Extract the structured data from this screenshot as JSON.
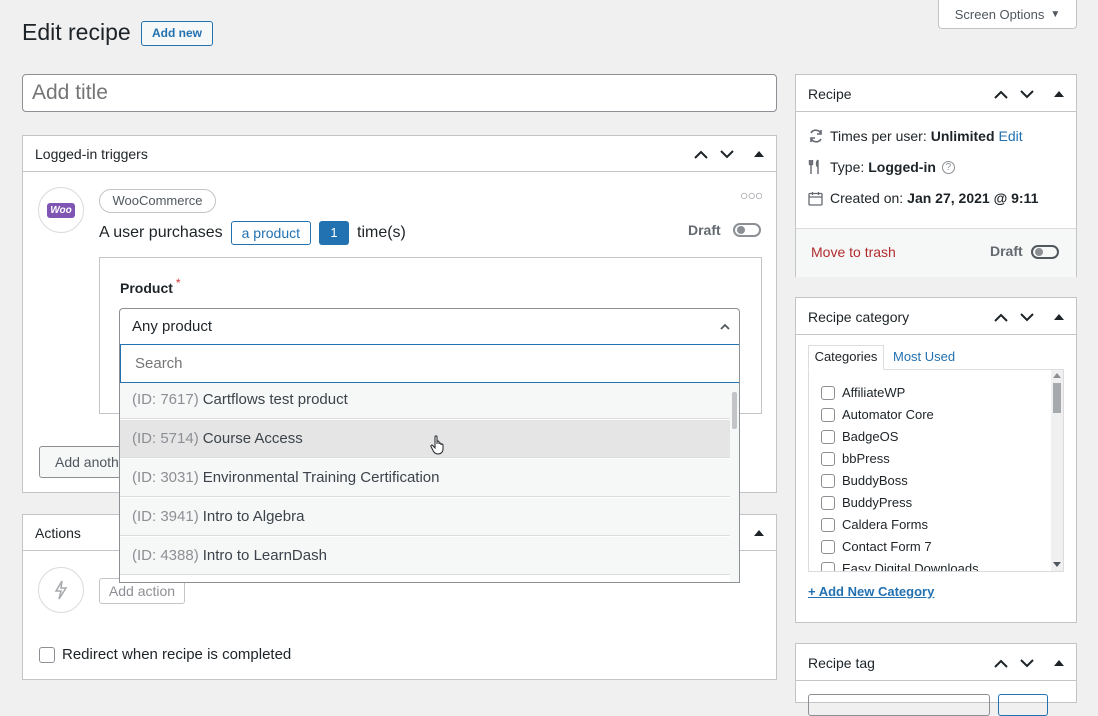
{
  "header": {
    "title": "Edit recipe",
    "add_new": "Add new",
    "screen_options": "Screen Options"
  },
  "title_field": {
    "placeholder": "Add title",
    "value": ""
  },
  "triggers": {
    "title": "Logged-in triggers",
    "integration": "WooCommerce",
    "logo_text": "Woo",
    "sentence_start": "A user purchases",
    "product_token": "a product",
    "count": "1",
    "sentence_end": "time(s)",
    "status": "Draft",
    "field_label": "Product",
    "required_mark": "*",
    "select_value": "Any product",
    "search_placeholder": "Search",
    "add_another": "Add anoth",
    "options": [
      {
        "id": "(ID: 7617)",
        "name": "Cartflows test product"
      },
      {
        "id": "(ID: 5714)",
        "name": "Course Access"
      },
      {
        "id": "(ID: 3031)",
        "name": "Environmental Training Certification"
      },
      {
        "id": "(ID: 3941)",
        "name": "Intro to Algebra"
      },
      {
        "id": "(ID: 4388)",
        "name": "Intro to LearnDash"
      }
    ]
  },
  "actions": {
    "title": "Actions",
    "add_action": "Add action",
    "redirect_label": "Redirect when recipe is completed"
  },
  "recipe_box": {
    "title": "Recipe",
    "times_label": "Times per user:",
    "times_value": "Unlimited",
    "times_edit": "Edit",
    "type_label": "Type:",
    "type_value": "Logged-in",
    "created_label": "Created on:",
    "created_value": "Jan 27, 2021 @ 9:11",
    "trash": "Move to trash",
    "status": "Draft"
  },
  "category_box": {
    "title": "Recipe category",
    "tab_categories": "Categories",
    "tab_most_used": "Most Used",
    "items": [
      "AffiliateWP",
      "Automator Core",
      "BadgeOS",
      "bbPress",
      "BuddyBoss",
      "BuddyPress",
      "Caldera Forms",
      "Contact Form 7",
      "Easy Digital Downloads"
    ],
    "add_new": "+ Add New Category"
  },
  "tag_box": {
    "title": "Recipe tag"
  },
  "colors": {
    "accent": "#2271b1",
    "trash": "#b32d2e",
    "woo": "#7f54b3"
  }
}
